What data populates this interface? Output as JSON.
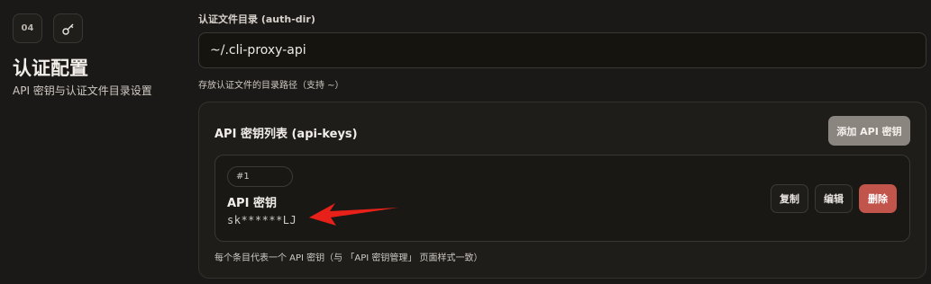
{
  "section": {
    "number": "04",
    "icon": "key-icon",
    "title": "认证配置",
    "description": "API 密钥与认证文件目录设置"
  },
  "auth_dir": {
    "label": "认证文件目录 (auth-dir)",
    "value": "~/.cli-proxy-api",
    "hint": "存放认证文件的目录路径（支持 ~）"
  },
  "api_keys": {
    "title": "API 密钥列表 (api-keys)",
    "add_button": "添加 API 密钥",
    "items": [
      {
        "index": "#1",
        "label": "API 密钥",
        "value": "sk******LJ",
        "copy_button": "复制",
        "edit_button": "编辑",
        "delete_button": "删除"
      }
    ],
    "footnote": "每个条目代表一个 API 密钥（与 「API 密钥管理」 页面样式一致）"
  },
  "colors": {
    "background": "#1b1917",
    "delete_accent": "#c1544b",
    "annotation_arrow": "#e8201a"
  }
}
